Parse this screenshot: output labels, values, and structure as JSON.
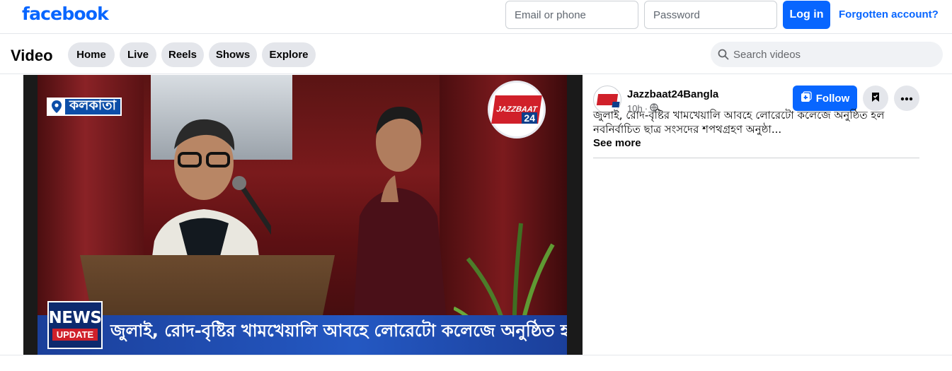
{
  "header": {
    "logo": "facebook",
    "email_placeholder": "Email or phone",
    "password_placeholder": "Password",
    "login_label": "Log in",
    "forgot_label": "Forgotten account?"
  },
  "nav": {
    "title": "Video",
    "tabs": [
      {
        "label": "Home"
      },
      {
        "label": "Live"
      },
      {
        "label": "Reels"
      },
      {
        "label": "Shows"
      },
      {
        "label": "Explore"
      }
    ],
    "search_placeholder": "Search videos"
  },
  "video": {
    "location_badge": "কলকাতা",
    "channel_logo_text": "JAZZBAAT",
    "channel_logo_num": "24",
    "news_label": "NEWS",
    "update_label": "UPDATE",
    "ticker_text": "জুলাই, রোদ-বৃষ্টির খামখেয়ালি আবহে লোরেটো কলেজে অনুষ্ঠিত হল"
  },
  "post": {
    "page_name": "Jazzbaat24Bangla",
    "time": "10h",
    "follow_label": "Follow",
    "caption": "জুলাই, রোদ-বৃষ্টির খামখেয়ালি আবহে লোরেটো কলেজে অনুষ্ঠিত হল নবনির্বাচিত ছাত্র সংসদের শপথগ্রহণ অনুষ্ঠা...",
    "see_more": "See more"
  },
  "colors": {
    "brand": "#0866ff",
    "pill_bg": "#e4e6eb",
    "ticker": "#2458c2",
    "news_red": "#d0202a"
  },
  "icons": [
    "search-icon",
    "location-pin-icon",
    "globe-icon",
    "follow-plus-icon",
    "save-icon",
    "more-icon"
  ]
}
